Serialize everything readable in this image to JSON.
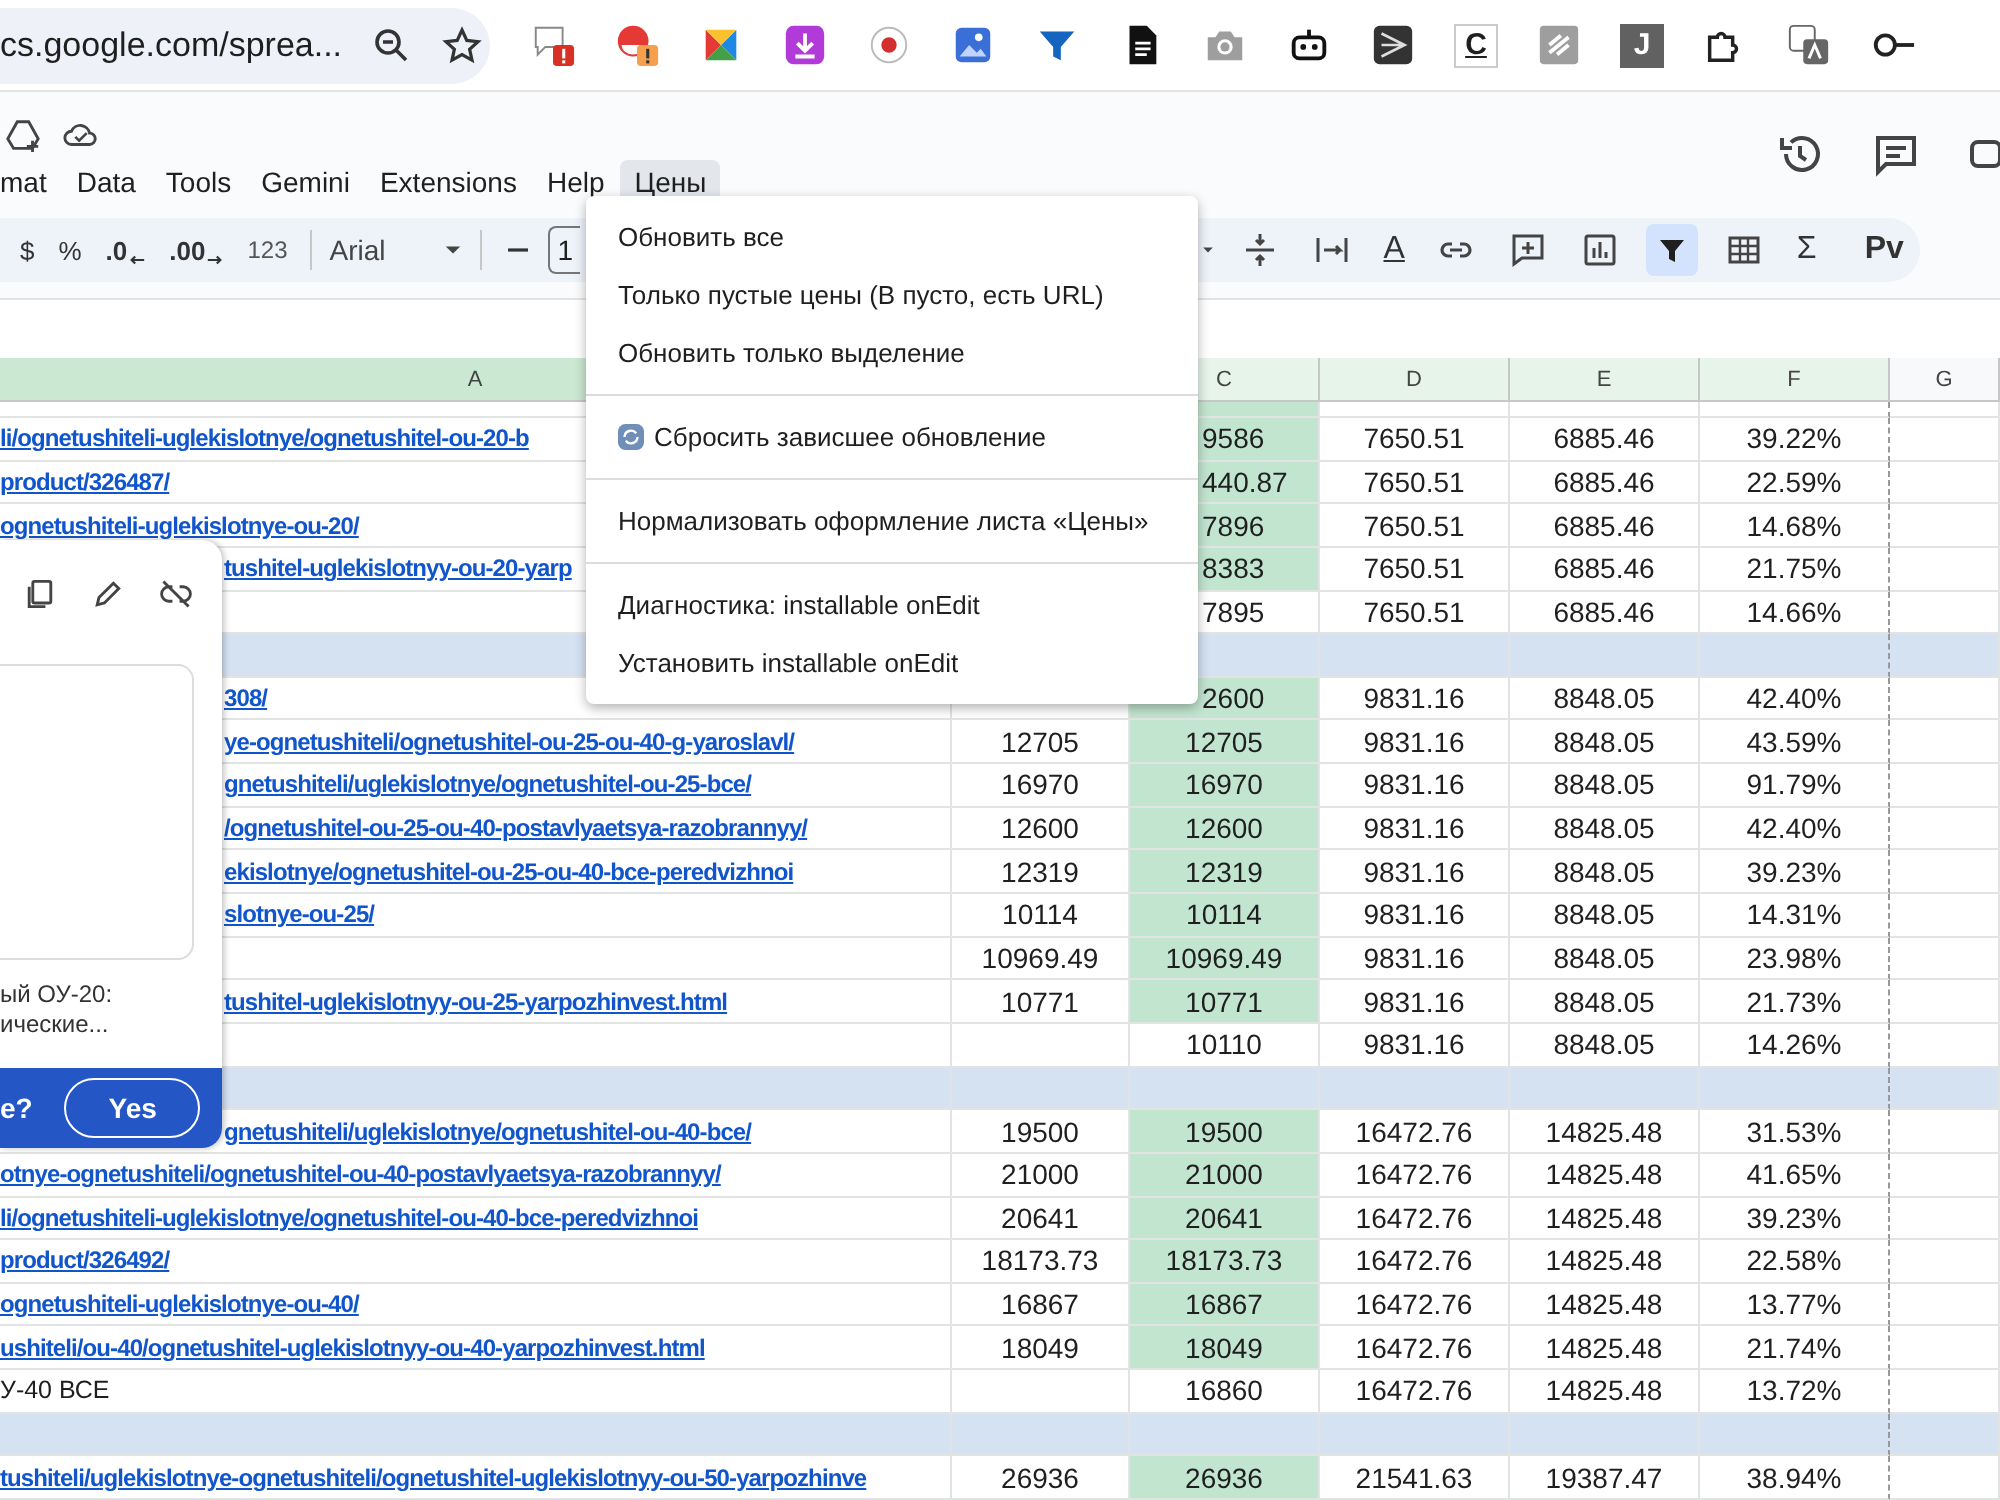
{
  "browser": {
    "address": "cs.google.com/sprea...",
    "extensions": [
      {
        "kind": "alert-chat"
      },
      {
        "kind": "alert-avatar"
      },
      {
        "kind": "pinwheel"
      },
      {
        "kind": "download"
      },
      {
        "kind": "record"
      },
      {
        "kind": "photo"
      },
      {
        "kind": "funnel"
      },
      {
        "kind": "docs"
      },
      {
        "kind": "camera"
      },
      {
        "kind": "robot"
      },
      {
        "kind": "tile"
      },
      {
        "kind": "letter",
        "text": "C",
        "dark": false
      },
      {
        "kind": "slash"
      },
      {
        "kind": "letter",
        "text": "J",
        "dark": true
      },
      {
        "kind": "puzzle"
      },
      {
        "kind": "translate"
      },
      {
        "kind": "key"
      }
    ]
  },
  "menubar": [
    {
      "label": "mat",
      "selected": false
    },
    {
      "label": "Data",
      "selected": false
    },
    {
      "label": "Tools",
      "selected": false
    },
    {
      "label": "Gemini",
      "selected": false
    },
    {
      "label": "Extensions",
      "selected": false
    },
    {
      "label": "Help",
      "selected": false
    },
    {
      "label": "Цены",
      "selected": true
    }
  ],
  "toolbar": {
    "left": [
      {
        "kind": "text",
        "text": "$"
      },
      {
        "kind": "text",
        "text": "%"
      },
      {
        "kind": "decimal-less",
        "text": ".0"
      },
      {
        "kind": "decimal-more",
        "text": ".00"
      },
      {
        "kind": "small",
        "text": "123"
      }
    ],
    "font": "Arial",
    "font_size": "1",
    "right": [
      {
        "kind": "caret",
        "on": false
      },
      {
        "kind": "valign",
        "on": false
      },
      {
        "kind": "wrap",
        "on": false
      },
      {
        "kind": "textcolor",
        "text": "A",
        "on": false
      },
      {
        "kind": "link",
        "on": false
      },
      {
        "kind": "comment",
        "on": false
      },
      {
        "kind": "chart",
        "on": false
      },
      {
        "kind": "filter",
        "on": true
      },
      {
        "kind": "table",
        "on": false
      },
      {
        "kind": "text",
        "text": "Σ",
        "on": false
      },
      {
        "kind": "text",
        "text": "Pv",
        "on": false
      }
    ]
  },
  "menu": [
    {
      "kind": "item",
      "label": "Обновить все"
    },
    {
      "kind": "item",
      "label": "Только пустые цены (В пусто, есть URL)"
    },
    {
      "kind": "item",
      "label": "Обновить только выделение"
    },
    {
      "kind": "divider"
    },
    {
      "kind": "refresh-item",
      "label": "Сбросить зависшее обновление"
    },
    {
      "kind": "divider"
    },
    {
      "kind": "item",
      "label": "Нормализовать оформление листа «Цены»"
    },
    {
      "kind": "divider"
    },
    {
      "kind": "item",
      "label": "Диагностика: installable onEdit"
    },
    {
      "kind": "item",
      "label": "Установить installable onEdit"
    }
  ],
  "link_popup": {
    "text": "ый ОУ-20: ические...",
    "prompt": "e?",
    "button": "Yes"
  },
  "columns": [
    {
      "label": "A",
      "selected": true,
      "tinted": true
    },
    {
      "label": "C",
      "selected": false,
      "tinted": true
    },
    {
      "label": "D",
      "selected": false,
      "tinted": true
    },
    {
      "label": "E",
      "selected": false,
      "tinted": true
    },
    {
      "label": "F",
      "selected": false,
      "tinted": true
    },
    {
      "label": "G",
      "selected": false,
      "tinted": false
    }
  ],
  "rows": [
    {
      "kind": "data",
      "a": "li/ognetushiteli-uglekislotnye/ognetushitel-ou-20-b",
      "link": true,
      "c": "9586",
      "c_fill": true,
      "d": "7650.51",
      "e": "6885.46",
      "f": "39.22%"
    },
    {
      "kind": "data",
      "a": "product/326487/",
      "link": true,
      "c": "440.87",
      "c_fill": true,
      "d": "7650.51",
      "e": "6885.46",
      "f": "22.59%"
    },
    {
      "kind": "data",
      "a": "ognetushiteli-uglekislotnye-ou-20/",
      "link": true,
      "c": "7896",
      "c_fill": true,
      "d": "7650.51",
      "e": "6885.46",
      "f": "14.68%"
    },
    {
      "kind": "data",
      "a": "tushitel-uglekislotnyy-ou-20-yarp",
      "link": true,
      "c": "8383",
      "c_fill": true,
      "d": "7650.51",
      "e": "6885.46",
      "f": "21.75%"
    },
    {
      "kind": "data",
      "c": "7895",
      "c_fill": false,
      "d": "7650.51",
      "e": "6885.46",
      "f": "14.66%"
    },
    {
      "kind": "separator"
    },
    {
      "kind": "data",
      "a": "308/",
      "link": true,
      "c": "2600",
      "c_fill": true,
      "d": "9831.16",
      "e": "8848.05",
      "f": "42.40%"
    },
    {
      "kind": "data",
      "a": "ye-ognetushiteli/ognetushitel-ou-25-ou-40-g-yaroslavl/",
      "link": true,
      "b": "12705",
      "c": "12705",
      "c_fill": true,
      "d": "9831.16",
      "e": "8848.05",
      "f": "43.59%"
    },
    {
      "kind": "data",
      "a": "gnetushiteli/uglekislotnye/ognetushitel-ou-25-bce/",
      "link": true,
      "b": "16970",
      "c": "16970",
      "c_fill": true,
      "d": "9831.16",
      "e": "8848.05",
      "f": "91.79%"
    },
    {
      "kind": "data",
      "a": "/ognetushitel-ou-25-ou-40-postavlyaetsya-razobrannyy/",
      "link": true,
      "b": "12600",
      "c": "12600",
      "c_fill": true,
      "d": "9831.16",
      "e": "8848.05",
      "f": "42.40%"
    },
    {
      "kind": "data",
      "a": "ekislotnye/ognetushitel-ou-25-ou-40-bce-peredvizhnoi",
      "link": true,
      "b": "12319",
      "c": "12319",
      "c_fill": true,
      "d": "9831.16",
      "e": "8848.05",
      "f": "39.23%"
    },
    {
      "kind": "data",
      "a": "slotnye-ou-25/",
      "link": true,
      "b": "10114",
      "c": "10114",
      "c_fill": true,
      "d": "9831.16",
      "e": "8848.05",
      "f": "14.31%"
    },
    {
      "kind": "data",
      "b": "10969.49",
      "c": "10969.49",
      "c_fill": true,
      "d": "9831.16",
      "e": "8848.05",
      "f": "23.98%"
    },
    {
      "kind": "data",
      "a": "tushitel-uglekislotnyy-ou-25-yarpozhinvest.html",
      "link": true,
      "b": "10771",
      "c": "10771",
      "c_fill": true,
      "d": "9831.16",
      "e": "8848.05",
      "f": "21.73%"
    },
    {
      "kind": "data",
      "c": "10110",
      "c_fill": false,
      "d": "9831.16",
      "e": "8848.05",
      "f": "14.26%"
    },
    {
      "kind": "separator"
    },
    {
      "kind": "data",
      "a": "gnetushiteli/uglekislotnye/ognetushitel-ou-40-bce/",
      "link": true,
      "b": "19500",
      "c": "19500",
      "c_fill": true,
      "d": "16472.76",
      "e": "14825.48",
      "f": "31.53%"
    },
    {
      "kind": "data",
      "a": "otnye-ognetushiteli/ognetushitel-ou-40-postavlyaetsya-razobrannyy/",
      "link": true,
      "b": "21000",
      "c": "21000",
      "c_fill": true,
      "d": "16472.76",
      "e": "14825.48",
      "f": "41.65%"
    },
    {
      "kind": "data",
      "a": "li/ognetushiteli-uglekislotnye/ognetushitel-ou-40-bce-peredvizhnoi",
      "link": true,
      "b": "20641",
      "c": "20641",
      "c_fill": true,
      "d": "16472.76",
      "e": "14825.48",
      "f": "39.23%"
    },
    {
      "kind": "data",
      "a": "product/326492/",
      "link": true,
      "b": "18173.73",
      "c": "18173.73",
      "c_fill": true,
      "d": "16472.76",
      "e": "14825.48",
      "f": "22.58%"
    },
    {
      "kind": "data",
      "a": "ognetushiteli-uglekislotnye-ou-40/",
      "link": true,
      "b": "16867",
      "c": "16867",
      "c_fill": true,
      "d": "16472.76",
      "e": "14825.48",
      "f": "13.77%"
    },
    {
      "kind": "data",
      "a": "ushiteli/ou-40/ognetushitel-uglekislotnyy-ou-40-yarpozhinvest.html",
      "link": true,
      "b": "18049",
      "c": "18049",
      "c_fill": true,
      "d": "16472.76",
      "e": "14825.48",
      "f": "21.74%"
    },
    {
      "kind": "data",
      "a": "У-40 ВСЕ",
      "link": false,
      "c": "16860",
      "c_fill": false,
      "d": "16472.76",
      "e": "14825.48",
      "f": "13.72%"
    },
    {
      "kind": "separator"
    },
    {
      "kind": "data",
      "a": "tushiteli/uglekislotnye-ognetushiteli/ognetushitel-uglekislotnyy-ou-50-yarpozhinve",
      "link": true,
      "b": "26936",
      "c": "26936",
      "c_fill": true,
      "d": "21541.63",
      "e": "19387.47",
      "f": "38.94%"
    }
  ]
}
